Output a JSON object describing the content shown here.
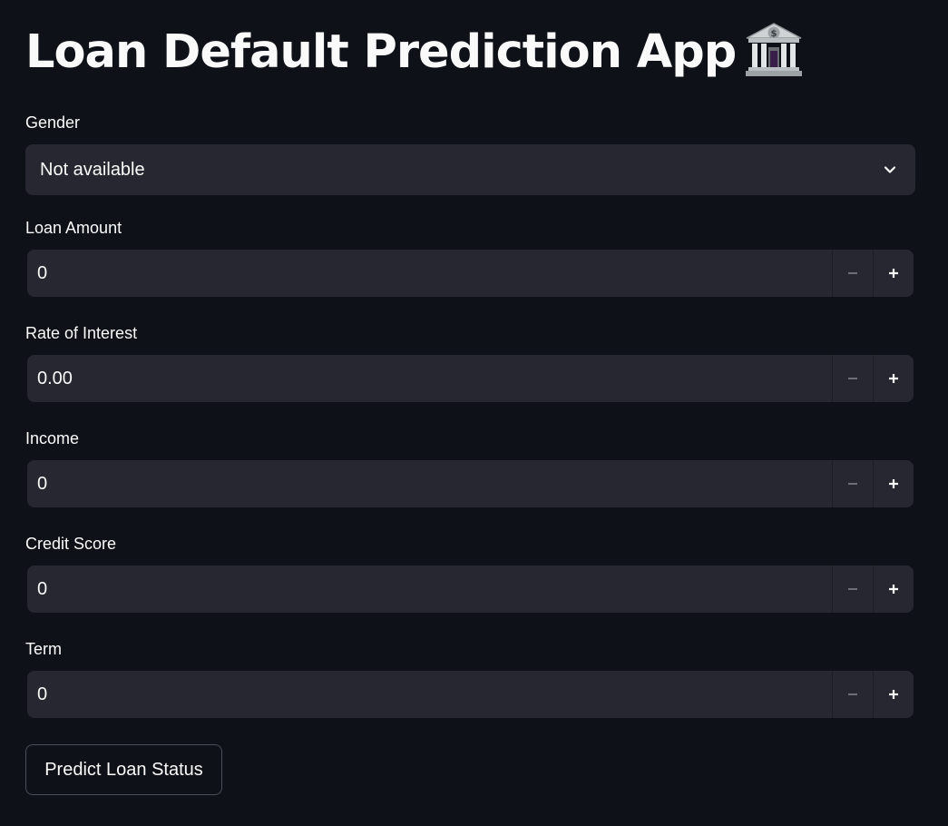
{
  "title": "Loan Default Prediction App",
  "title_emoji": "bank-building-icon",
  "gender": {
    "label": "Gender",
    "selected": "Not available"
  },
  "loan_amount": {
    "label": "Loan Amount",
    "value": "0"
  },
  "rate_of_interest": {
    "label": "Rate of Interest",
    "value": "0.00"
  },
  "income": {
    "label": "Income",
    "value": "0"
  },
  "credit_score": {
    "label": "Credit Score",
    "value": "0"
  },
  "term": {
    "label": "Term",
    "value": "0"
  },
  "predict_button": {
    "label": "Predict Loan Status"
  },
  "colors": {
    "background": "#0e1117",
    "input_bg": "#262730",
    "text": "#fafafa",
    "muted": "#6c6e78"
  }
}
